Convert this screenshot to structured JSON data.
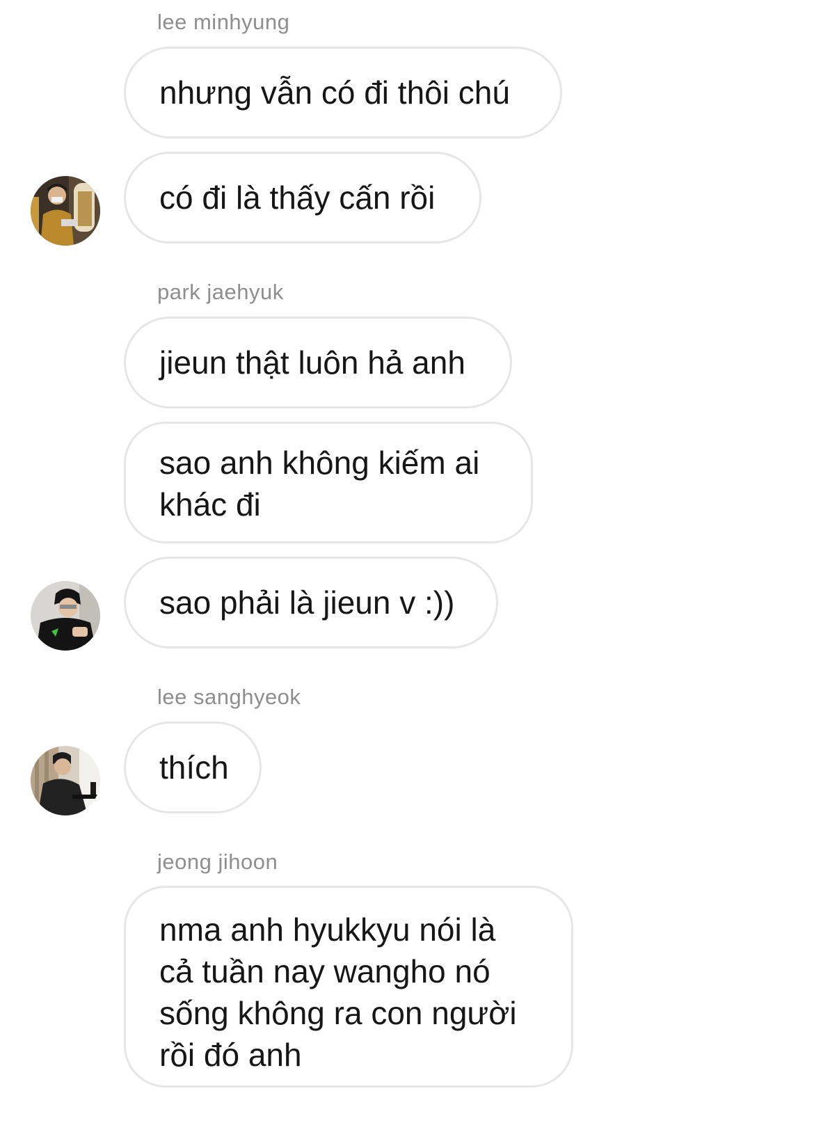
{
  "chat": {
    "groups": [
      {
        "sender": "lee minhyung",
        "messages": [
          "nhưng vẫn có đi thôi chú",
          "có đi là thấy cấn rồi"
        ],
        "avatar_icon": "user-photo-avatar"
      },
      {
        "sender": "park jaehyuk",
        "messages": [
          "jieun thật luôn hả anh",
          "sao anh không kiếm ai\nkhác đi",
          "sao phải là jieun v :))"
        ],
        "avatar_icon": "user-photo-avatar"
      },
      {
        "sender": "lee sanghyeok",
        "messages": [
          "thích"
        ],
        "avatar_icon": "user-photo-avatar"
      },
      {
        "sender": "jeong jihoon",
        "messages": [
          "nma anh hyukkyu nói là\ncả tuần nay wangho nó\nsống không ra con người\nrồi đó anh"
        ]
      }
    ]
  },
  "colors": {
    "bubble_border": "#e6e6e6",
    "sender_text": "#8e8e8e",
    "message_text": "#161616",
    "background": "#ffffff"
  }
}
